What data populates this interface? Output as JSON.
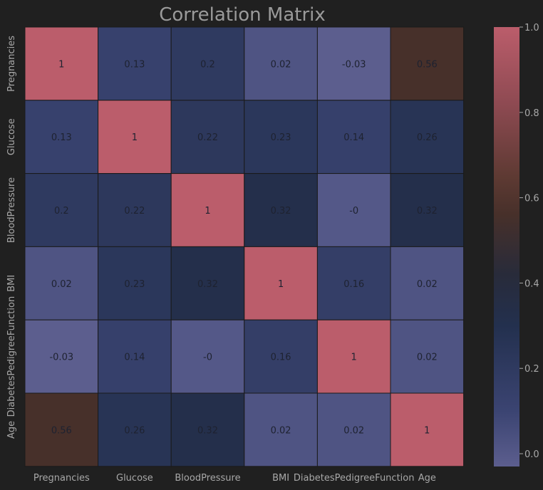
{
  "chart_data": {
    "type": "heatmap",
    "title": "Correlation Matrix",
    "x_labels": [
      "Pregnancies",
      "Glucose",
      "BloodPressure",
      "BMI",
      "DiabetesPedigreeFunction",
      "Age"
    ],
    "y_labels": [
      "Pregnancies",
      "Glucose",
      "BloodPressure",
      "BMI",
      "DiabetesPedigreeFunction",
      "Age"
    ],
    "values": [
      [
        1,
        0.13,
        0.2,
        0.02,
        -0.03,
        0.56
      ],
      [
        0.13,
        1,
        0.22,
        0.23,
        0.14,
        0.26
      ],
      [
        0.2,
        0.22,
        1,
        0.32,
        0,
        0.32
      ],
      [
        0.02,
        0.23,
        0.32,
        1,
        0.16,
        0.02
      ],
      [
        -0.03,
        0.14,
        0,
        0.16,
        1,
        0.02
      ],
      [
        0.56,
        0.26,
        0.32,
        0.02,
        0.02,
        1
      ]
    ],
    "cell_text": [
      [
        "1",
        "0.13",
        "0.2",
        "0.02",
        "-0.03",
        "0.56"
      ],
      [
        "0.13",
        "1",
        "0.22",
        "0.23",
        "0.14",
        "0.26"
      ],
      [
        "0.2",
        "0.22",
        "1",
        "0.32",
        "-0",
        "0.32"
      ],
      [
        "0.02",
        "0.23",
        "0.32",
        "1",
        "0.16",
        "0.02"
      ],
      [
        "-0.03",
        "0.14",
        "-0",
        "0.16",
        "1",
        "0.02"
      ],
      [
        "0.56",
        "0.26",
        "0.32",
        "0.02",
        "0.02",
        "1"
      ]
    ],
    "colorbar": {
      "range": [
        -0.03,
        1.0
      ],
      "ticks": [
        "0.0",
        "0.2",
        "0.4",
        "0.6",
        "0.8",
        "1.0"
      ],
      "tick_values": [
        0.0,
        0.2,
        0.4,
        0.6,
        0.8,
        1.0
      ],
      "color_stops": [
        {
          "v": -0.03,
          "color": "#5c5e8e"
        },
        {
          "v": 0.1,
          "color": "#3b4472"
        },
        {
          "v": 0.3,
          "color": "#23304e"
        },
        {
          "v": 0.42,
          "color": "#282b3a"
        },
        {
          "v": 0.56,
          "color": "#47302a"
        },
        {
          "v": 0.65,
          "color": "#5e3a33"
        },
        {
          "v": 0.82,
          "color": "#8e4a52"
        },
        {
          "v": 1.0,
          "color": "#bb5d6b"
        }
      ]
    },
    "colors": {
      "background": "#202020",
      "grid_line": "#1a1a1a",
      "text": "#a8a8a8",
      "cell_text": "#1e2230"
    }
  }
}
